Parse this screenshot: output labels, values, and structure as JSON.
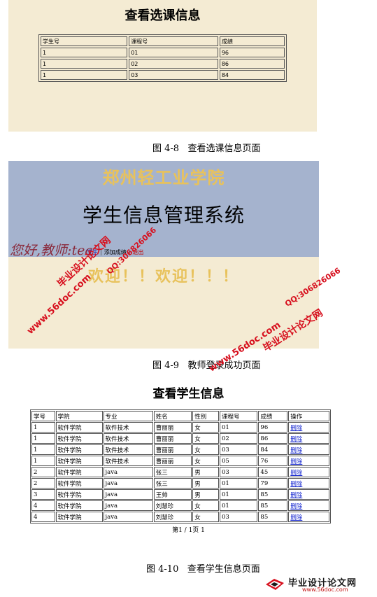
{
  "fig8": {
    "title": "查看选课信息",
    "headers": [
      "学生号",
      "课程号",
      "成绩"
    ],
    "rows": [
      [
        "1",
        "01",
        "96"
      ],
      [
        "1",
        "02",
        "86"
      ],
      [
        "1",
        "03",
        "84"
      ]
    ],
    "caption": "图 4-8   查看选课信息页面"
  },
  "fig9": {
    "school": "郑州轻工业学院",
    "system": "学生信息管理系统",
    "greeting": "您好,教师:tea",
    "menu": {
      "item1": "学生",
      "item2": "添加成绩",
      "logout": "退出"
    },
    "welcome": "欢迎！！欢迎！！！",
    "caption": "图 4-9   教师登录成功页面"
  },
  "watermark": {
    "site_name": "毕业设计论文网",
    "url": "www.56doc.com",
    "qq": "QQ:306826066"
  },
  "fig10": {
    "title": "查看学生信息",
    "headers": [
      "学号",
      "学院",
      "专业",
      "姓名",
      "性别",
      "课程号",
      "成绩",
      "操作"
    ],
    "rows": [
      [
        "1",
        "软件学院",
        "软件技术",
        "曹丽丽",
        "女",
        "01",
        "96",
        "删除"
      ],
      [
        "1",
        "软件学院",
        "软件技术",
        "曹丽丽",
        "女",
        "02",
        "86",
        "删除"
      ],
      [
        "1",
        "软件学院",
        "软件技术",
        "曹丽丽",
        "女",
        "03",
        "84",
        "删除"
      ],
      [
        "1",
        "软件学院",
        "软件技术",
        "曹丽丽",
        "女",
        "05",
        "76",
        "删除"
      ],
      [
        "2",
        "软件学院",
        "java",
        "张三",
        "男",
        "03",
        "45",
        "删除"
      ],
      [
        "2",
        "软件学院",
        "java",
        "张三",
        "男",
        "01",
        "79",
        "删除"
      ],
      [
        "3",
        "软件学院",
        "java",
        "王帅",
        "男",
        "01",
        "85",
        "删除"
      ],
      [
        "4",
        "软件学院",
        "java",
        "刘慧珍",
        "女",
        "01",
        "85",
        "删除"
      ],
      [
        "4",
        "软件学院",
        "java",
        "刘慧珍",
        "女",
        "03",
        "85",
        "删除"
      ]
    ],
    "pager": "第1 / 1页 1",
    "caption": "图 4-10   查看学生信息页面"
  },
  "logo": {
    "name": "毕业设计论文网",
    "url": "www.56doc.com"
  },
  "colors": {
    "panel_bg": "#f4ebd3",
    "banner_bg": "#a5b3ce",
    "gold": "#e8c25c",
    "watermark_red": "#d7101e"
  }
}
